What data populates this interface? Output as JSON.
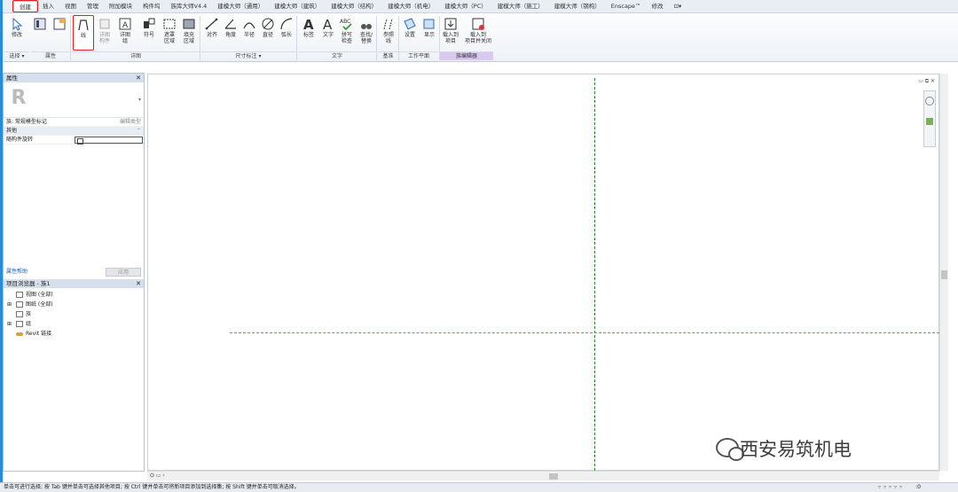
{
  "tabs": [
    "创建",
    "插入",
    "视图",
    "管理",
    "附加模块",
    "构件坞",
    "族库大师V4.4",
    "建模大师（通用）",
    "建模大师（建筑）",
    "建模大师（结构）",
    "建模大师（机电）",
    "建模大师（PC）",
    "建模大师（施工）",
    "建模大师（钢构）",
    "Enscape™",
    "修改",
    "⊡▾"
  ],
  "ribbon": {
    "buttons": [
      {
        "label": "修改",
        "state": "normal"
      },
      {
        "label": "线",
        "state": "highlighted"
      },
      {
        "label": "详图\n构件",
        "state": "gray"
      },
      {
        "label": "详图\n组",
        "state": "normal"
      },
      {
        "label": "符号",
        "state": "normal"
      },
      {
        "label": "遮罩\n区域",
        "state": "normal"
      },
      {
        "label": "填充\n区域",
        "state": "normal"
      },
      {
        "label": "对齐",
        "state": "normal"
      },
      {
        "label": "角度",
        "state": "normal"
      },
      {
        "label": "半径",
        "state": "normal"
      },
      {
        "label": "直径",
        "state": "normal"
      },
      {
        "label": "弧长",
        "state": "normal"
      },
      {
        "label": "标签",
        "state": "normal"
      },
      {
        "label": "文字",
        "state": "normal"
      },
      {
        "label": "拼写\n检查",
        "state": "normal"
      },
      {
        "label": "查找/\n替换",
        "state": "normal"
      },
      {
        "label": "参照\n线",
        "state": "normal"
      },
      {
        "label": "设置",
        "state": "normal"
      },
      {
        "label": "显示",
        "state": "normal"
      },
      {
        "label": "载入到\n项目",
        "state": "normal"
      },
      {
        "label": "载入到\n项目并关闭",
        "state": "normal"
      }
    ],
    "panels": [
      "选择 ▾",
      "属性",
      "详图",
      "尺寸标注 ▾",
      "文字",
      "基准",
      "工作平面",
      "族编辑器"
    ]
  },
  "properties": {
    "title": "属性",
    "family_type": "族: 常规模型标记",
    "edit_type": "编辑类型",
    "section": "其他",
    "param_label": "随构件旋转",
    "help_link": "属性帮助",
    "apply": "应用"
  },
  "browser": {
    "title": "项目浏览器 - 族1",
    "items": [
      {
        "label": "视图 (全部)",
        "expander": ""
      },
      {
        "label": "图纸 (全部)",
        "expander": "⊞"
      },
      {
        "label": "族",
        "expander": ""
      },
      {
        "label": "组",
        "expander": "⊞"
      },
      {
        "label": "Revit 链接",
        "expander": ""
      }
    ]
  },
  "watermark": "西安易筑机电",
  "status_text": "单击可进行选择; 按 Tab 键并单击可选择其他项目; 按 Ctrl 键并单击可将新项目添加到选择集; 按 Shift 键并单击可取消选择。",
  "status_zero": ":0"
}
